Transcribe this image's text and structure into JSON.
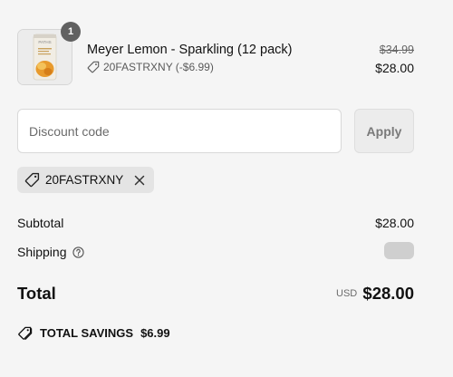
{
  "line_item": {
    "quantity": "1",
    "title": "Meyer Lemon - Sparkling (12 pack)",
    "discount_text": "20FASTRXNY (-$6.99)",
    "original_price": "$34.99",
    "final_price": "$28.00",
    "thumbnail_brand": "PATHS",
    "icons": {
      "discount": "tag-icon"
    }
  },
  "discount": {
    "placeholder": "Discount code",
    "value": "",
    "apply_label": "Apply",
    "applied_code": "20FASTRXNY",
    "icons": {
      "chip": "tag-icon",
      "remove": "close-icon"
    }
  },
  "summary": {
    "subtotal_label": "Subtotal",
    "subtotal_value": "$28.00",
    "shipping_label": "Shipping",
    "total_label": "Total",
    "currency": "USD",
    "total_value": "$28.00",
    "savings_label": "TOTAL SAVINGS",
    "savings_value": "$6.99",
    "icons": {
      "shipping_help": "help-circle-icon",
      "savings": "tags-icon"
    }
  },
  "colors": {
    "background": "#f5f5f5",
    "badge": "#616161",
    "chip_background": "#e4e4e4",
    "button_background": "#ececec"
  }
}
